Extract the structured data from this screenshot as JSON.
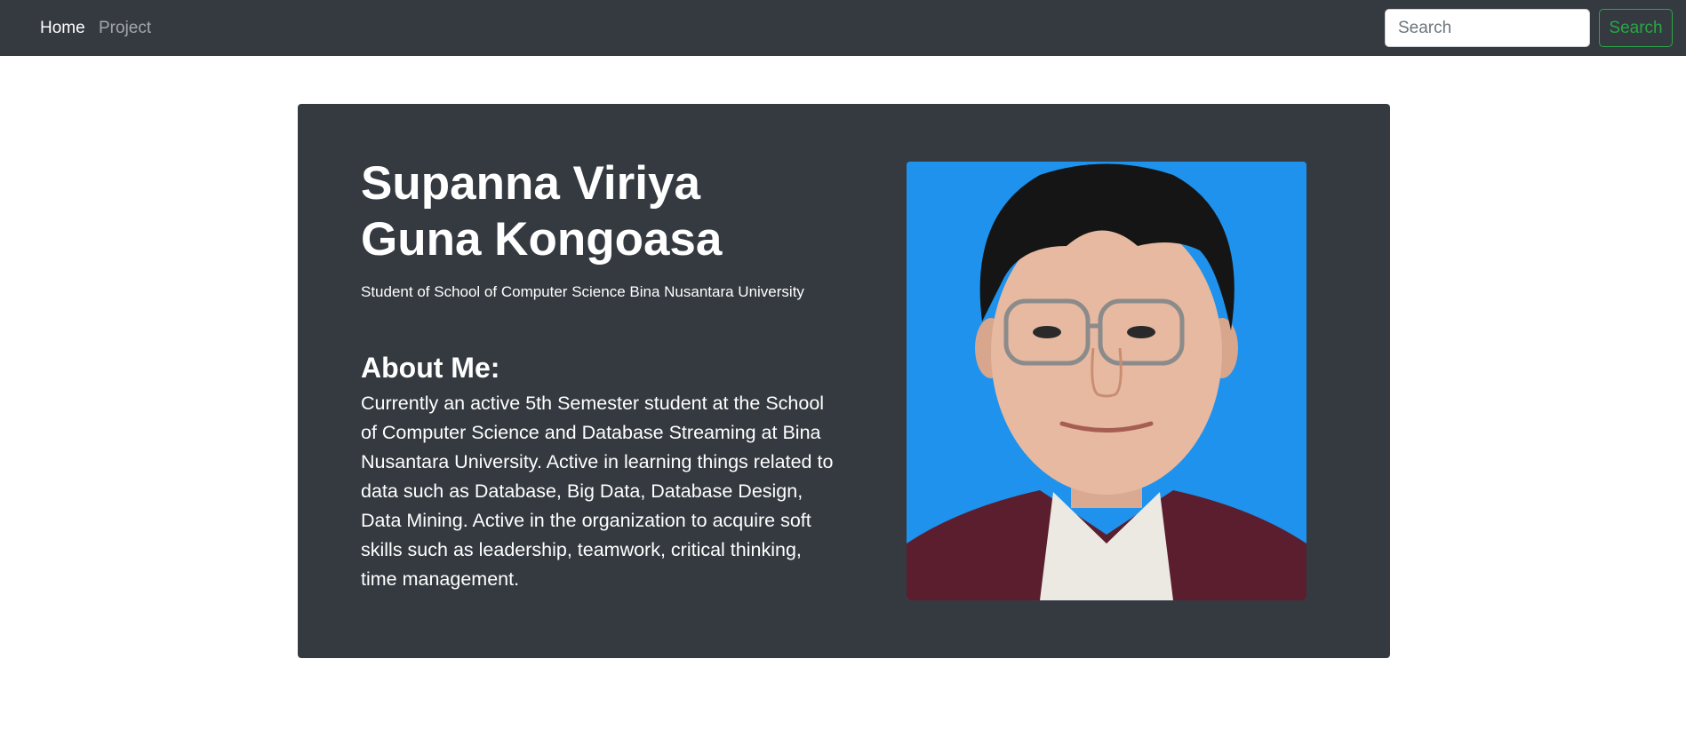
{
  "navbar": {
    "links": [
      {
        "label": "Home",
        "active": true
      },
      {
        "label": "Project",
        "active": false
      }
    ],
    "search": {
      "placeholder": "Search",
      "value": "",
      "button_label": "Search"
    }
  },
  "hero": {
    "name_line1": "Supanna Viriya",
    "name_line2": "Guna Kongoasa",
    "subtitle": "Student of School of Computer Science Bina Nusantara University",
    "about_heading": "About Me:",
    "about_text": "Currently an active 5th Semester student at the School of Computer Science and Database Streaming at Bina Nusantara University. Active in learning things related to data such as Database, Big Data, Database Design, Data Mining. Active in the organization to acquire soft skills such as leadership, teamwork, critical thinking, time management."
  },
  "colors": {
    "navbar_bg": "#343a40",
    "card_bg": "#343a40",
    "photo_bg": "#1e92ec",
    "search_button": "#28a745"
  }
}
